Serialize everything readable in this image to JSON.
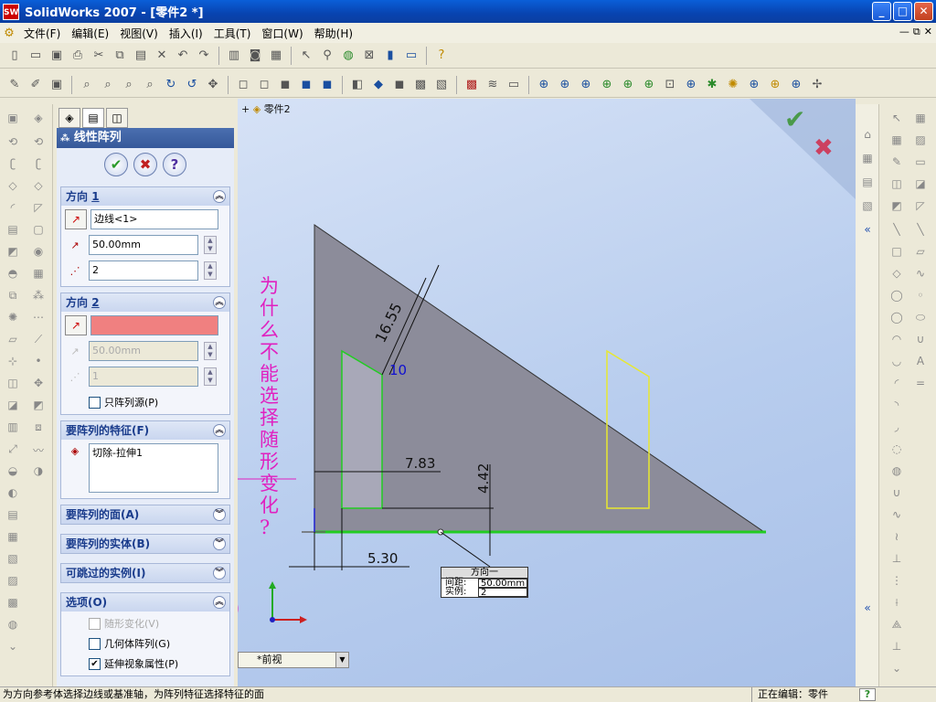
{
  "window": {
    "title": "SolidWorks 2007 - [零件2 *]",
    "app_icon": "SW",
    "buttons": [
      "_",
      "□",
      "✕"
    ]
  },
  "menu": [
    "文件(F)",
    "编辑(E)",
    "视图(V)",
    "插入(I)",
    "工具(T)",
    "窗口(W)",
    "帮助(H)"
  ],
  "menu_right": [
    "—",
    "⧉",
    "✕"
  ],
  "feature_tree": {
    "root": "零件2"
  },
  "panel": {
    "title": "线性阵列",
    "dir1": {
      "header": "方向",
      "header_num": "1",
      "edge": "边线<1>",
      "distance": "50.00mm",
      "count": "2"
    },
    "dir2": {
      "header": "方向",
      "header_num": "2",
      "distance": "50.00mm",
      "count": "1",
      "only_seed_label": "只阵列源(P)"
    },
    "features": {
      "header": "要阵列的特征(F)",
      "item": "切除-拉伸1"
    },
    "faces": {
      "header": "要阵列的面(A)"
    },
    "bodies": {
      "header": "要阵列的实体(B)"
    },
    "skip": {
      "header": "可跳过的实例(I)"
    },
    "options": {
      "header": "选项(O)",
      "vary_sketch": "随形变化(V)",
      "geometry_pattern": "几何体阵列(G)",
      "propagate": "延伸视象属性(P)"
    }
  },
  "graphics": {
    "dims": [
      "16.55",
      "10",
      "7.83",
      "4.42",
      "5.30"
    ],
    "callout": {
      "title": "方向一",
      "spacing_label": "间距:",
      "spacing": "50.00mm",
      "count_label": "实例:",
      "count": "2"
    },
    "annotation": [
      "为",
      "什",
      "么",
      "不",
      "能",
      "选",
      "择",
      "随",
      "形",
      "变",
      "化",
      "?"
    ]
  },
  "view_selector": "*前视",
  "status": {
    "hint": "为方向参考体选择边线或基准轴，为阵列特征选择特征的面",
    "mode": "正在编辑：零件",
    "help": "?"
  },
  "colors": {
    "sketch_green": "#22cc22",
    "sketch_yellow": "#e8e830",
    "part_gray": "#8c8c9a",
    "annotation": "#e020c0",
    "dim_blue": "#1010d0"
  }
}
